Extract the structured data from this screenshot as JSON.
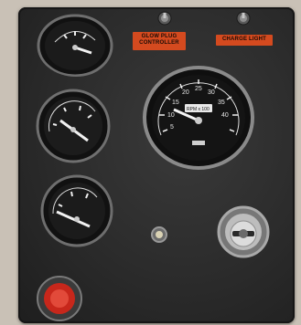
{
  "labels": {
    "glow_plug": [
      "GLOW PLUG",
      "CONTROLLER"
    ],
    "charge": "CHARGE LIGHT"
  },
  "tachometer": {
    "scale": [
      "5",
      "10",
      "15",
      "20",
      "25",
      "30",
      "35",
      "40"
    ],
    "unit_text": "RPM x 100"
  },
  "colors": {
    "panel": "#2b2b2b",
    "label_orange": "#d44a1f",
    "bezel": "#7a7a7a"
  },
  "icons": [
    "gauge-icon",
    "toggle-switch-icon",
    "key-switch-icon",
    "indicator-lamp-icon",
    "push-button-icon"
  ]
}
